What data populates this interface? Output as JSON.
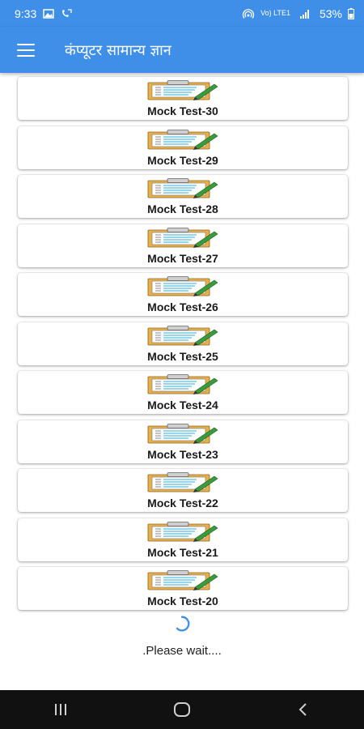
{
  "status_bar": {
    "time": "9:33",
    "battery": "53%",
    "network_label": "Vo) LTE1"
  },
  "app_bar": {
    "title": "कंप्यूटर सामान्य ज्ञान",
    "menu_icon": "hamburger-menu-icon"
  },
  "tests": [
    {
      "label": "Mock Test-30",
      "icon": "clipboard-pencil-icon"
    },
    {
      "label": "Mock Test-29",
      "icon": "clipboard-pencil-icon"
    },
    {
      "label": "Mock Test-28",
      "icon": "clipboard-pencil-icon"
    },
    {
      "label": "Mock Test-27",
      "icon": "clipboard-pencil-icon"
    },
    {
      "label": "Mock Test-26",
      "icon": "clipboard-pencil-icon"
    },
    {
      "label": "Mock Test-25",
      "icon": "clipboard-pencil-icon"
    },
    {
      "label": "Mock Test-24",
      "icon": "clipboard-pencil-icon"
    },
    {
      "label": "Mock Test-23",
      "icon": "clipboard-pencil-icon"
    },
    {
      "label": "Mock Test-22",
      "icon": "clipboard-pencil-icon"
    },
    {
      "label": "Mock Test-21",
      "icon": "clipboard-pencil-icon"
    },
    {
      "label": "Mock Test-20",
      "icon": "clipboard-pencil-icon"
    }
  ],
  "loading": {
    "text": ".Please wait...."
  },
  "colors": {
    "primary": "#3f8ee8",
    "nav_bar": "#111111",
    "clipboard": "#e9b04a",
    "pencil": "#3a9a3e"
  }
}
